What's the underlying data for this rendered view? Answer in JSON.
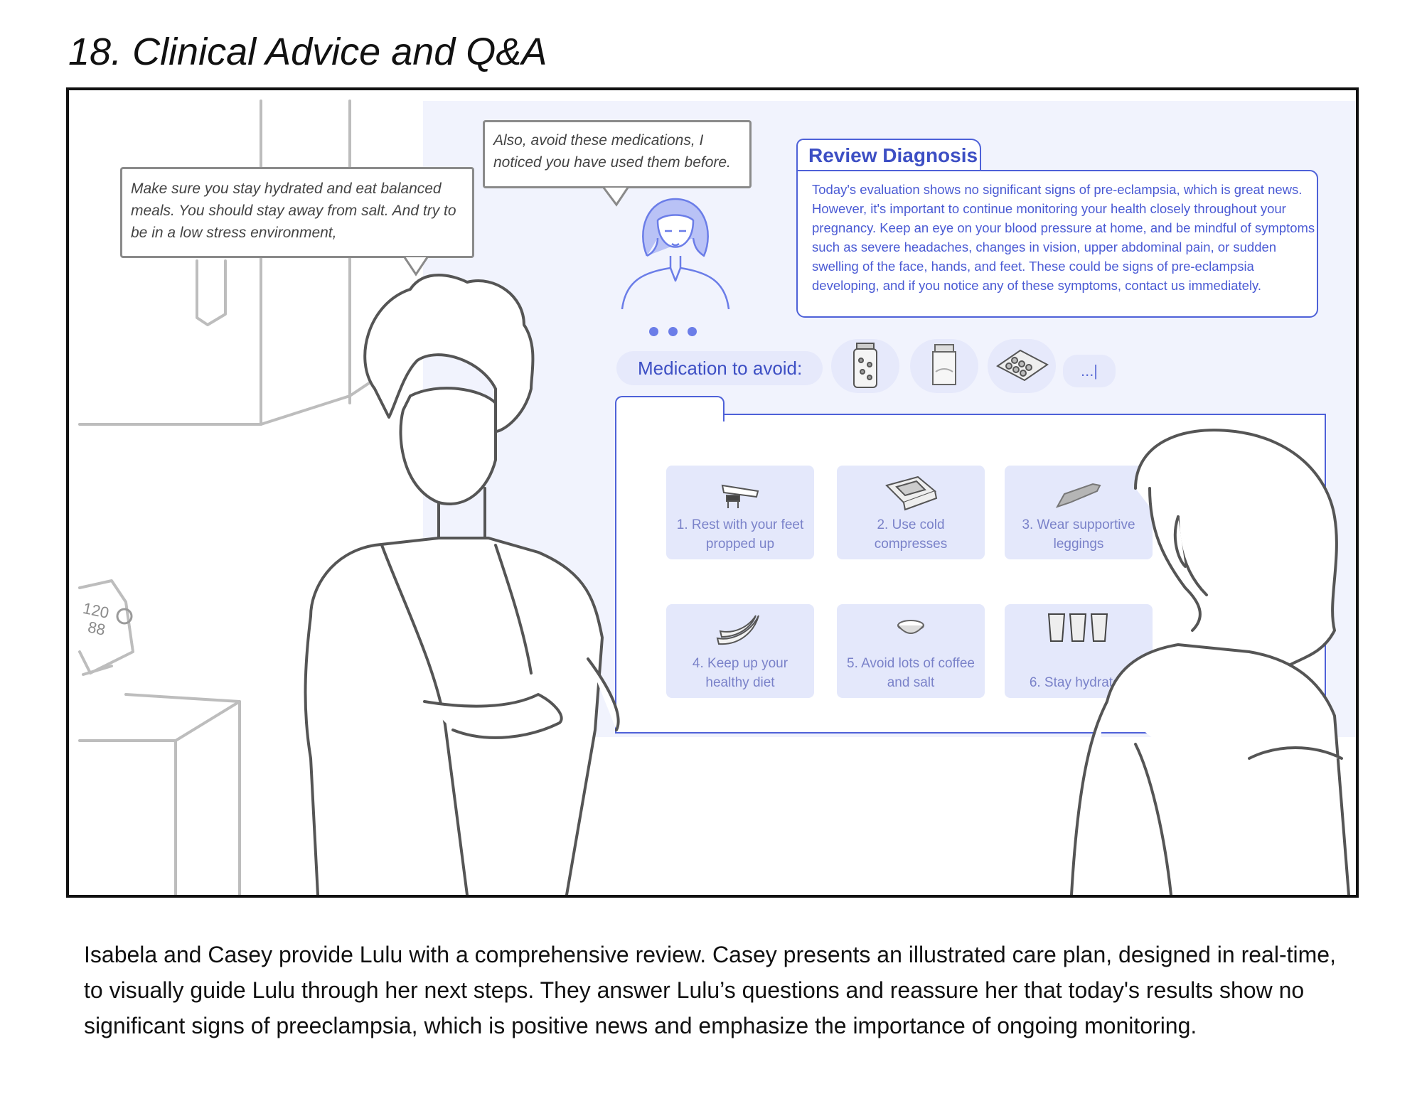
{
  "title": "18. Clinical Advice and Q&A",
  "bubbles": {
    "doctor": "Make sure you stay hydrated and eat balanced meals. You should stay away from salt. And try to be in a low stress environment,",
    "assistant": "Also, avoid these medications, I noticed you have used them before."
  },
  "diagnosis": {
    "title": "Review Diagnosis",
    "body": "Today's evaluation shows no significant signs of pre-eclampsia, which is great news. However, it's important to continue monitoring your health closely throughout your pregnancy. Keep an eye on your blood pressure at home, and be mindful of symptoms such as severe headaches, changes in vision, upper abdominal pain, or sudden swelling of the face, hands, and feet. These could be signs of pre-eclampsia developing, and if you notice any of these symptoms, contact us immediately."
  },
  "medications": {
    "label": "Medication to avoid:",
    "more": "...|",
    "icons": [
      "pill-bottle-icon",
      "powder-jar-icon",
      "blister-pack-icon"
    ]
  },
  "care_plan": [
    {
      "label": "1. Rest with your feet propped up",
      "icon": "feet-up-icon"
    },
    {
      "label": "2. Use cold compresses",
      "icon": "cold-compress-icon"
    },
    {
      "label": "3. Wear supportive leggings",
      "icon": "leggings-icon"
    },
    {
      "label": "4. Keep up your healthy diet",
      "icon": "bananas-icon"
    },
    {
      "label": "5. Avoid lots of coffee and salt",
      "icon": "salt-bowl-icon"
    },
    {
      "label": "6. Stay hydrated",
      "icon": "water-glasses-icon"
    }
  ],
  "bp_monitor": {
    "reading": "120",
    "sub": "88"
  },
  "caption": "Isabela and Casey provide Lulu with a comprehensive review. Casey presents an illustrated care plan, designed in real-time, to visually guide Lulu through her next steps. They answer Lulu’s questions and reassure her that today's results show no significant signs of preeclampsia, which is positive news and emphasize the importance of ongoing monitoring.",
  "colors": {
    "accent": "#4e61d8",
    "screen": "#f1f3fd",
    "card": "#e4e8fb",
    "line": "#555555"
  }
}
